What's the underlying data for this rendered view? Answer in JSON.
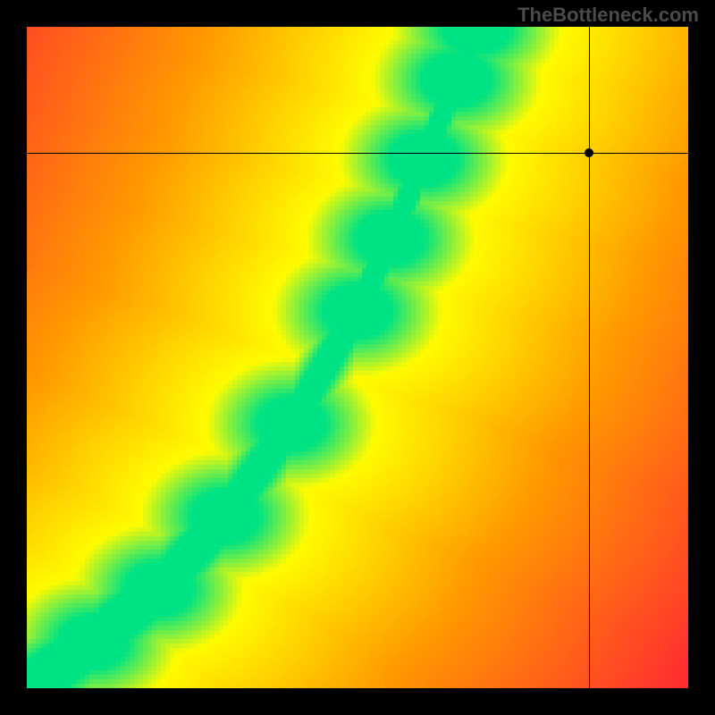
{
  "watermark": "TheBottleneck.com",
  "chart_data": {
    "type": "heatmap",
    "title": "",
    "xlabel": "",
    "ylabel": "",
    "xlim": [
      0,
      100
    ],
    "ylim": [
      0,
      100
    ],
    "description": "Bottleneck compatibility heatmap. Color indicates bottleneck severity: green = balanced (optimal), yellow = slight imbalance, red = strong bottleneck. A curved green band from bottom-left to upper-middle marks the balanced pairing line.",
    "color_scale": {
      "balanced": "#00e384",
      "near": "#fffb00",
      "mid": "#ff9a00",
      "bottleneck": "#ff183a"
    },
    "marker": {
      "x": 85,
      "y": 81,
      "meaning": "Selected hardware pairing position on the heatmap"
    },
    "crosshair": {
      "x": 85,
      "y": 81
    },
    "optimal_curve_samples": [
      {
        "x": 0,
        "y": 0
      },
      {
        "x": 10,
        "y": 7
      },
      {
        "x": 20,
        "y": 15
      },
      {
        "x": 30,
        "y": 26
      },
      {
        "x": 40,
        "y": 40
      },
      {
        "x": 50,
        "y": 57
      },
      {
        "x": 55,
        "y": 68
      },
      {
        "x": 60,
        "y": 80
      },
      {
        "x": 65,
        "y": 92
      },
      {
        "x": 68,
        "y": 100
      }
    ]
  }
}
